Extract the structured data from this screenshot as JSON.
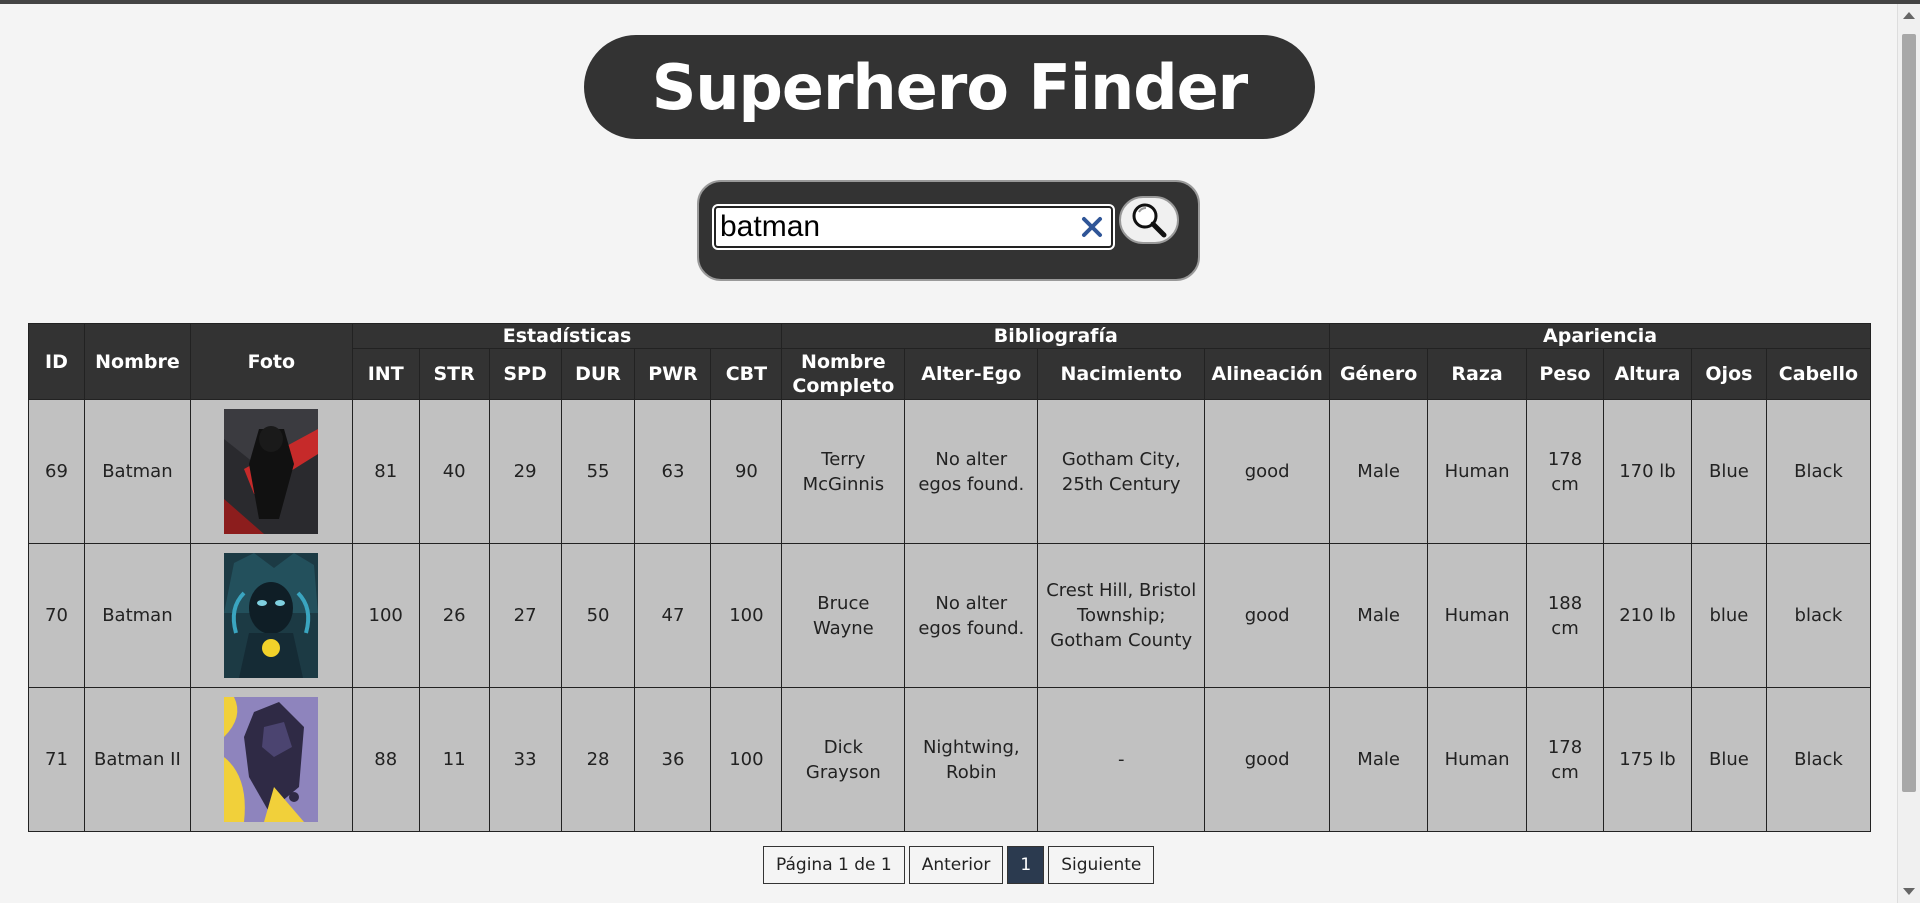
{
  "app": {
    "title": "Superhero Finder"
  },
  "search": {
    "value": "batman",
    "clear_icon": "close-icon",
    "search_icon": "magnifier-icon"
  },
  "table": {
    "groups": {
      "id": "ID",
      "name": "Nombre",
      "photo": "Foto",
      "stats": "Estadísticas",
      "bio": "Bibliografía",
      "appearance": "Apariencia"
    },
    "subheaders": [
      "INT",
      "STR",
      "SPD",
      "DUR",
      "PWR",
      "CBT",
      "Nombre Completo",
      "Alter-Ego",
      "Nacimiento",
      "Alineación",
      "Género",
      "Raza",
      "Peso",
      "Altura",
      "Ojos",
      "Cabello"
    ],
    "rows": [
      {
        "id": "69",
        "name": "Batman",
        "int": "81",
        "str": "40",
        "spd": "29",
        "dur": "55",
        "pwr": "63",
        "cbt": "90",
        "full_name": "Terry McGinnis",
        "alter_ego": "No alter egos found.",
        "birth": "Gotham City, 25th Century",
        "alignment": "good",
        "gender": "Male",
        "race": "Human",
        "weight": "178 cm",
        "height": "170 lb",
        "eyes": "Blue",
        "hair": "Black"
      },
      {
        "id": "70",
        "name": "Batman",
        "int": "100",
        "str": "26",
        "spd": "27",
        "dur": "50",
        "pwr": "47",
        "cbt": "100",
        "full_name": "Bruce Wayne",
        "alter_ego": "No alter egos found.",
        "birth": "Crest Hill, Bristol Township; Gotham County",
        "alignment": "good",
        "gender": "Male",
        "race": "Human",
        "weight": "188 cm",
        "height": "210 lb",
        "eyes": "blue",
        "hair": "black"
      },
      {
        "id": "71",
        "name": "Batman II",
        "int": "88",
        "str": "11",
        "spd": "33",
        "dur": "28",
        "pwr": "36",
        "cbt": "100",
        "full_name": "Dick Grayson",
        "alter_ego": "Nightwing, Robin",
        "birth": "-",
        "alignment": "good",
        "gender": "Male",
        "race": "Human",
        "weight": "178 cm",
        "height": "175 lb",
        "eyes": "Blue",
        "hair": "Black"
      }
    ]
  },
  "pagination": {
    "info": "Página 1 de 1",
    "prev": "Anterior",
    "current": "1",
    "next": "Siguiente"
  },
  "colors": {
    "header_bg": "#333333",
    "cell_bg": "#c1c1c1",
    "page_bg": "#f4f4f4",
    "active_page": "#2b3a4f"
  }
}
